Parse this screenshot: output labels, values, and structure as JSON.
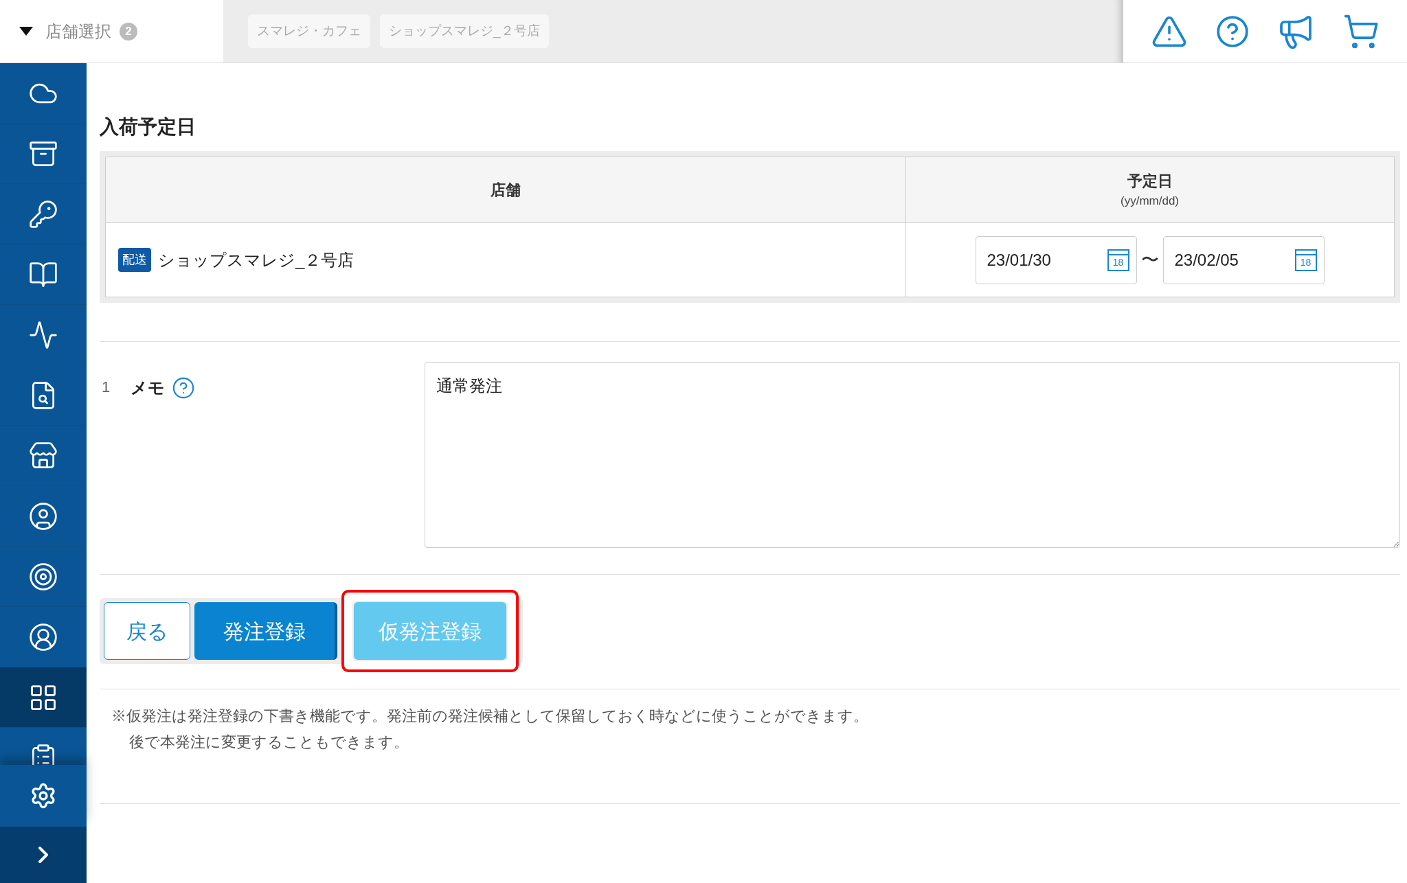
{
  "store_selector": {
    "label": "店舗選択",
    "count": "2"
  },
  "selected_stores": [
    "スマレジ・カフェ",
    "ショップスマレジ_２号店"
  ],
  "sidebar": {
    "items": [
      {
        "selected": false
      },
      {
        "selected": false
      },
      {
        "selected": false
      },
      {
        "selected": false
      },
      {
        "selected": false
      },
      {
        "selected": false
      },
      {
        "selected": false
      },
      {
        "selected": false
      },
      {
        "selected": false
      },
      {
        "selected": false
      },
      {
        "selected": true
      },
      {
        "selected": false
      }
    ]
  },
  "section_title": "入荷予定日",
  "table": {
    "columns": [
      {
        "label": "店舗"
      },
      {
        "label": "予定日",
        "sublabel": "(yy/mm/dd)"
      }
    ],
    "rows": [
      {
        "tag": "配送",
        "store": "ショップスマレジ_２号店",
        "separator": "〜",
        "dates": [
          {
            "value": "23/01/30",
            "icon_text": "18"
          },
          {
            "value": "23/02/05",
            "icon_text": "18"
          }
        ]
      }
    ]
  },
  "memo": {
    "number": "1",
    "label": "メモ",
    "value": "通常発注"
  },
  "buttons": [
    {
      "label": "戻る",
      "kind": "outline",
      "highlighted": false
    },
    {
      "label": "発注登録",
      "kind": "primary",
      "highlighted": false
    },
    {
      "label": "仮発注登録",
      "kind": "light",
      "highlighted": true
    }
  ],
  "note": {
    "lines": [
      "※仮発注は発注登録の下書き機能です。発注前の発注候補として保留しておく時などに使うことができます。",
      "後で本発注に変更することもできます。"
    ]
  }
}
